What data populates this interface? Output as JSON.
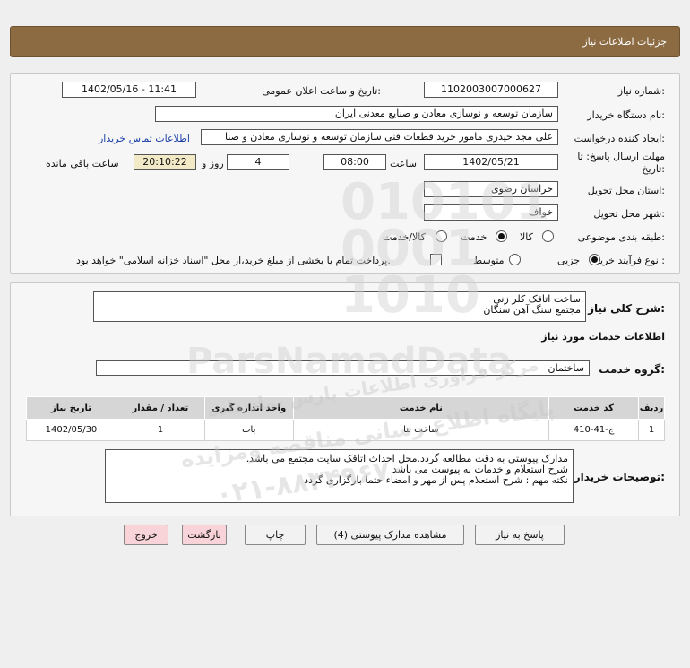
{
  "header": {
    "title": "جزئیات اطلاعات نیاز"
  },
  "form": {
    "need_number_label": "شماره نیاز:",
    "need_number": "1102003007000627",
    "announce_label": "تاریخ و ساعت اعلان عمومی:",
    "announce_value": "1402/05/16 - 11:41",
    "buyer_label": "نام دستگاه خریدار:",
    "buyer_value": "سازمان توسعه و نوسازی معادن و صنایع معدنی ایران",
    "creator_label": "ایجاد کننده درخواست:",
    "creator_value": "علی مجد حیدری مامور خرید قطعات فنی سازمان توسعه و نوسازی معادن و صنا",
    "contact_link": "اطلاعات تماس خریدار",
    "deadline_label": "مهلت ارسال پاسخ: تا تاریخ:",
    "deadline_date": "1402/05/21",
    "time_label": "ساعت",
    "deadline_time": "08:00",
    "days_value": "4",
    "days_label": "روز و",
    "remaining_time": "20:10:22",
    "remaining_label": "ساعت باقی مانده",
    "province_label": "استان محل تحویل:",
    "province_value": "خراسان رضوی",
    "city_label": "شهر محل تحویل:",
    "city_value": "خواف",
    "category_label": "طبقه بندی موضوعی:",
    "cat_goods": "کالا",
    "cat_service": "خدمت",
    "cat_both": "کالا/خدمت",
    "process_label": "نوع فرآیند خرید :",
    "proc_partial": "جزیی",
    "proc_medium": "متوسط",
    "payment_note": "پرداخت تمام یا بخشی از مبلغ خرید،از محل \"اسناد خزانه اسلامی\" خواهد بود."
  },
  "desc": {
    "label": "شرح کلی نیاز:",
    "line1": "ساخت اتاقک کلر زنی",
    "line2": "مجتمع سنگ آهن سنگان"
  },
  "services": {
    "section_title": "اطلاعات خدمات مورد نیاز",
    "group_label": "گروه خدمت:",
    "group_value": "ساختمان"
  },
  "table": {
    "headers": [
      "ردیف",
      "کد خدمت",
      "نام خدمت",
      "واحد اندازه گیری",
      "تعداد / مقدار",
      "تاریخ نیاز"
    ],
    "rows": [
      [
        "1",
        "ج-41-410",
        "ساخت بنا",
        "باب",
        "1",
        "1402/05/30"
      ]
    ]
  },
  "notes": {
    "label": "توضیحات خریدار:",
    "line1": "مدارک پیوستی به دقت مطالعه گردد.محل احداث اتاقک سایت مجتمع می باشد.",
    "line2": "شرح استعلام و خدمات به پیوست می باشد",
    "line3": "نکته مهم : شرح استعلام پس از مهر و امضاء حتما بارگزاری گردد"
  },
  "buttons": {
    "respond": "پاسخ به نیاز",
    "view_docs": "مشاهده مدارک پیوستی (4)",
    "print": "چاپ",
    "back": "بازگشت",
    "exit": "خروج"
  },
  "watermark": {
    "brand": "ParsNamadData",
    "line1": "مرکز فراوری اطلاعات پارس نماد داده",
    "line2": "پایگاه اطلاع رسانی مناقصه ومزایده",
    "phone": "۰۲۱-۸۸۳۴۹۶۷۰"
  }
}
